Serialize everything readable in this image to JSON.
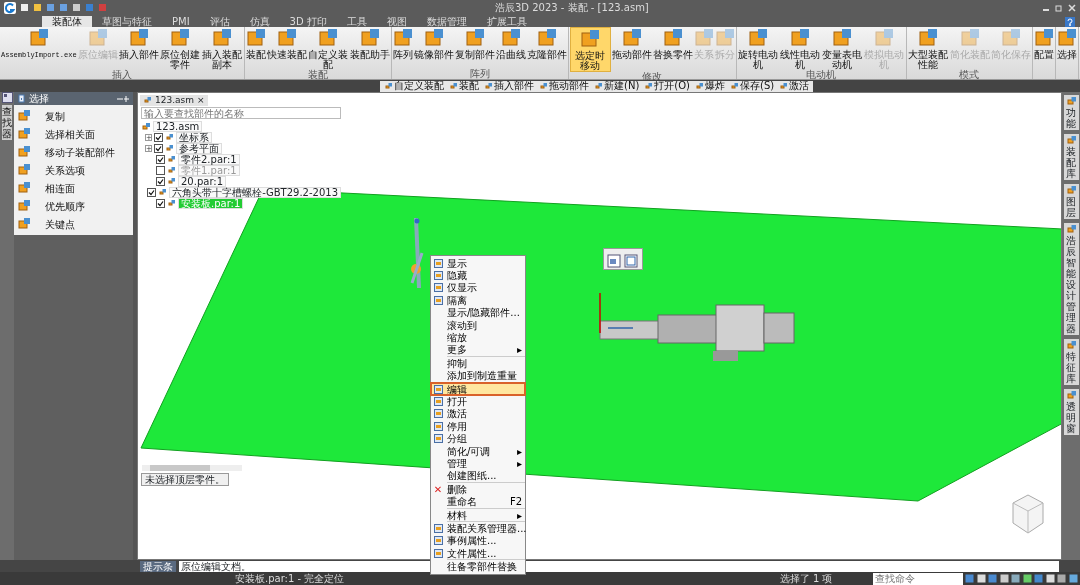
{
  "window": {
    "title": "浩辰3D 2023 - 装配 - [123.asm]"
  },
  "ribbon_tabs": [
    {
      "label": "装配体",
      "selected": true
    },
    {
      "label": "草图与特征",
      "selected": false
    },
    {
      "label": "PMI",
      "selected": false
    },
    {
      "label": "评估",
      "selected": false
    },
    {
      "label": "仿真",
      "selected": false
    },
    {
      "label": "3D 打印",
      "selected": false
    },
    {
      "label": "工具",
      "selected": false
    },
    {
      "label": "视图",
      "selected": false
    },
    {
      "label": "数据管理",
      "selected": false
    },
    {
      "label": "扩展工具",
      "selected": false
    }
  ],
  "ribbon_groups": [
    {
      "label": "插入",
      "buttons": [
        {
          "label": "AssemblyImport.exe",
          "disabled": false,
          "active": false
        },
        {
          "label": "原位编辑",
          "disabled": true,
          "active": false
        },
        {
          "label": "插入部件",
          "disabled": false,
          "active": false
        },
        {
          "label": "原位创建零件",
          "disabled": false,
          "active": false
        },
        {
          "label": "插入装配副本",
          "disabled": false,
          "active": false
        }
      ]
    },
    {
      "label": "装配",
      "buttons": [
        {
          "label": "装配",
          "disabled": false,
          "active": false
        },
        {
          "label": "快速装配",
          "disabled": false,
          "active": false
        },
        {
          "label": "自定义装配",
          "disabled": false,
          "active": false
        },
        {
          "label": "装配助手",
          "disabled": false,
          "active": false
        }
      ]
    },
    {
      "label": "阵列",
      "buttons": [
        {
          "label": "阵列",
          "disabled": false,
          "active": false
        },
        {
          "label": "镜像部件",
          "disabled": false,
          "active": false
        },
        {
          "label": "复制部件",
          "disabled": false,
          "active": false
        },
        {
          "label": "沿曲线",
          "disabled": false,
          "active": false
        },
        {
          "label": "克隆部件",
          "disabled": false,
          "active": false
        }
      ]
    },
    {
      "label": "修改",
      "buttons": [
        {
          "label": "选定时移动",
          "disabled": false,
          "active": true
        },
        {
          "label": "拖动部件",
          "disabled": false,
          "active": false
        },
        {
          "label": "替换零件",
          "disabled": false,
          "active": false
        },
        {
          "label": "关系",
          "disabled": true,
          "active": false
        },
        {
          "label": "拆分",
          "disabled": true,
          "active": false
        }
      ]
    },
    {
      "label": "电动机",
      "buttons": [
        {
          "label": "旋转电动机",
          "disabled": false,
          "active": false
        },
        {
          "label": "线性电动机",
          "disabled": false,
          "active": false
        },
        {
          "label": "变量表电动机",
          "disabled": false,
          "active": false
        },
        {
          "label": "模拟电动机",
          "disabled": true,
          "active": false
        }
      ]
    },
    {
      "label": "模式",
      "buttons": [
        {
          "label": "大型装配性能",
          "disabled": false,
          "active": false
        },
        {
          "label": "简化装配",
          "disabled": true,
          "active": false
        },
        {
          "label": "简化保存",
          "disabled": true,
          "active": false
        }
      ]
    },
    {
      "buttons": [
        {
          "label": "配置",
          "disabled": false,
          "active": false
        }
      ]
    },
    {
      "buttons": [
        {
          "label": "选择",
          "disabled": false,
          "active": false
        }
      ]
    }
  ],
  "command_bar": [
    "自定义装配",
    "装配",
    "插入部件",
    "拖动部件",
    "新建(N)",
    "打开(O)",
    "爆炸",
    "保存(S)",
    "激活"
  ],
  "left_tab": "查找器",
  "select_panel": {
    "title": "选择",
    "items": [
      "复制",
      "选择相关面",
      "移动子装配部件",
      "关系选项",
      "相连面",
      "优先顺序",
      "关键点"
    ]
  },
  "document_tab": {
    "label": "123.asm",
    "close": "×"
  },
  "tree": {
    "placeholder": "输入要查找部件的名称",
    "root": "123.asm",
    "items": [
      {
        "label": "坐标系",
        "expander": "+",
        "checked": true,
        "selected": false
      },
      {
        "label": "参考平面",
        "expander": "+",
        "checked": true,
        "selected": false
      },
      {
        "label": "零件2.par:1",
        "checked": true,
        "selected": false
      },
      {
        "label": "零件1.par:1",
        "checked": false,
        "selected": false
      },
      {
        "label": "20.par:1",
        "checked": true,
        "selected": false
      },
      {
        "label": "六角头带十字槽螺栓-GBT29.2-2013",
        "checked": true,
        "selected": false
      },
      {
        "label": "安装板.par:1",
        "checked": true,
        "selected": true
      }
    ],
    "filter": "未选择顶层零件。"
  },
  "context_menu": [
    {
      "kind": "icon-item",
      "label": "显示"
    },
    {
      "kind": "icon-item",
      "label": "隐藏"
    },
    {
      "kind": "icon-item",
      "label": "仅显示"
    },
    {
      "kind": "icon-item",
      "label": "隔离"
    },
    {
      "kind": "item",
      "label": "显示/隐藏部件..."
    },
    {
      "kind": "item",
      "label": "滚动到"
    },
    {
      "kind": "item",
      "label": "缩放"
    },
    {
      "kind": "submenu",
      "label": "更多",
      "arrow": "▸"
    },
    {
      "kind": "separator"
    },
    {
      "kind": "item",
      "label": "抑制"
    },
    {
      "kind": "item",
      "label": "添加到制造重量"
    },
    {
      "kind": "separator"
    },
    {
      "kind": "icon-item",
      "label": "编辑",
      "highlighted": true
    },
    {
      "kind": "icon-item",
      "label": "打开"
    },
    {
      "kind": "icon-item",
      "label": "激活"
    },
    {
      "kind": "icon-item",
      "label": "停用"
    },
    {
      "kind": "icon-item",
      "label": "分组"
    },
    {
      "kind": "submenu",
      "label": "简化/可调",
      "arrow": "▸"
    },
    {
      "kind": "submenu",
      "label": "管理",
      "arrow": "▸"
    },
    {
      "kind": "item",
      "label": "创建图纸..."
    },
    {
      "kind": "separator"
    },
    {
      "kind": "glyph-item",
      "label": "删除",
      "glyph": "✕"
    },
    {
      "kind": "item",
      "label": "重命名",
      "shortcut": "F2"
    },
    {
      "kind": "separator"
    },
    {
      "kind": "submenu",
      "label": "材料",
      "arrow": "▸"
    },
    {
      "kind": "separator"
    },
    {
      "kind": "icon-item",
      "label": "装配关系管理器..."
    },
    {
      "kind": "icon-item",
      "label": "事例属性..."
    },
    {
      "kind": "icon-item",
      "label": "文件属性..."
    },
    {
      "kind": "separator"
    },
    {
      "kind": "item",
      "label": "往备零部件替换"
    }
  ],
  "right_tabs": [
    "功能",
    "装配库",
    "图层",
    "浩辰智能设计管理器",
    "特征库",
    "透明窗"
  ],
  "hint_bar": {
    "label": "提示条",
    "text": "原位编辑文档。"
  },
  "status_bar": {
    "part": "安装板.par:1 - 完全定位",
    "selection": "选择了 1 项",
    "search_placeholder": "查找命令"
  }
}
